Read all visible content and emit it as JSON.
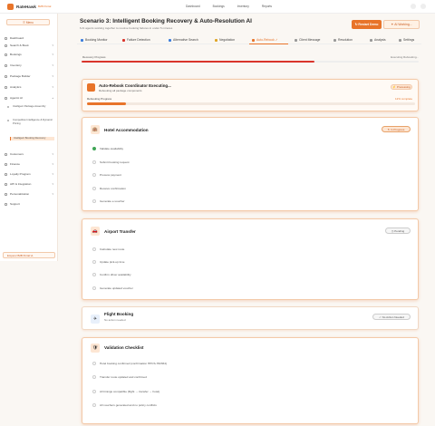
{
  "app": {
    "brand": "RateHawk",
    "brand_sub": "B2B Portal"
  },
  "topnav": [
    "Dashboard",
    "Bookings",
    "Inventory",
    "Reports"
  ],
  "sidebar": {
    "menu_label": "Menu",
    "items": [
      {
        "label": "Dashboard"
      },
      {
        "label": "Search & Book"
      },
      {
        "label": "Bookings"
      },
      {
        "label": "Inventory"
      },
      {
        "label": "Package Builder"
      },
      {
        "label": "Analytics"
      },
      {
        "label": "Agentic AI"
      }
    ],
    "sub_items": [
      {
        "label": "Intelligent Package Assembly"
      },
      {
        "label": "Competitive Intelligence & Dynamic Pricing"
      },
      {
        "label": "Intelligent Booking Recovery"
      }
    ],
    "items2": [
      {
        "label": "Customers"
      },
      {
        "label": "Finance"
      },
      {
        "label": "Loyalty Program"
      },
      {
        "label": "API & Integration"
      },
      {
        "label": "Personalization"
      },
      {
        "label": "Support"
      }
    ],
    "footer": "Emperor B2B Portal v1"
  },
  "header": {
    "title": "Scenario 3: Intelligent Booking Recovery & Auto-Resolution AI",
    "subtitle": "6 AI agents working together to resolve booking failures in under 5 minutes",
    "restart_label": "Restart Demo",
    "working_label": "AI Working..."
  },
  "tabs": [
    {
      "label": "Booking Monitor",
      "color": "#3b7ddd"
    },
    {
      "label": "Failure Detection",
      "color": "#d9342b"
    },
    {
      "label": "Alternative Search",
      "color": "#3b7ddd"
    },
    {
      "label": "Negotiation",
      "color": "#e0a526"
    },
    {
      "label": "Auto-Rebook",
      "color": "#e8742a"
    },
    {
      "label": "Client Message",
      "color": "#999999"
    },
    {
      "label": "Resolution",
      "color": "#999999"
    },
    {
      "label": "Analysis",
      "color": "#999999"
    },
    {
      "label": "Settings",
      "color": "#999999"
    }
  ],
  "active_tab": "Auto-Rebook",
  "recovery": {
    "label": "Recovery Progress",
    "status": "Executing Rebooking...",
    "progress": 0.69
  },
  "coordinator": {
    "title": "Auto-Rebook Coordinator Executing...",
    "subtitle": "Rebooking all package components",
    "badge": "Processing",
    "progress_label": "Rebooking Progress",
    "progress_value": "12% complete",
    "progress": 0.12
  },
  "hotel": {
    "title": "Hotel Accommodation",
    "badge": "In Progress",
    "steps": [
      {
        "label": "Validate availability",
        "done": true
      },
      {
        "label": "Submit booking request",
        "done": false
      },
      {
        "label": "Process payment",
        "done": false
      },
      {
        "label": "Receive confirmation",
        "done": false
      },
      {
        "label": "Generate e-voucher",
        "done": false
      }
    ]
  },
  "airport": {
    "title": "Airport Transfer",
    "badge": "Pending",
    "steps": [
      {
        "label": "Calculate new route",
        "done": false
      },
      {
        "label": "Update pick-up time",
        "done": false
      },
      {
        "label": "Confirm driver availability",
        "done": false
      },
      {
        "label": "Generate updated voucher",
        "done": false
      }
    ]
  },
  "flight": {
    "title": "Flight Booking",
    "subtitle": "No action needed",
    "badge": "No Action Needed"
  },
  "validation": {
    "title": "Validation Checklist",
    "steps": [
      {
        "label": "Hotel booking confirmed (confirmation HPCS-782364)",
        "done": false
      },
      {
        "label": "Transfer route updated and confirmed",
        "done": false
      },
      {
        "label": "All timings compatible (flight → transfer → hotel)",
        "done": false
      },
      {
        "label": "All vouchers generated and no policy conflicts",
        "done": false
      }
    ]
  },
  "colors": {
    "accent": "#e8742a",
    "danger": "#d9342b",
    "success": "#3fa556"
  }
}
